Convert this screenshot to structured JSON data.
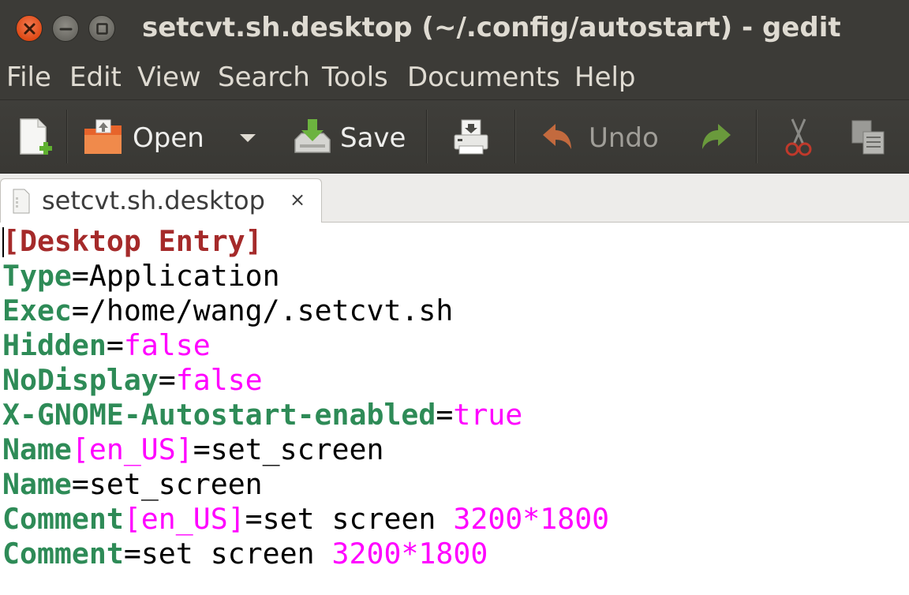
{
  "window": {
    "title": "setcvt.sh.desktop (~/.config/autostart) - gedit"
  },
  "menu": [
    "File",
    "Edit",
    "View",
    "Search",
    "Tools",
    "Documents",
    "Help"
  ],
  "toolbar": {
    "new_icon": "new-document-icon",
    "open_label": "Open",
    "save_label": "Save",
    "print_icon": "print-icon",
    "undo_label": "Undo",
    "redo_icon": "redo-icon",
    "cut_icon": "cut-icon",
    "copy_icon": "copy-icon"
  },
  "tab": {
    "label": "setcvt.sh.desktop",
    "close": "×"
  },
  "editor": {
    "lines": [
      {
        "section": "[Desktop Entry]"
      },
      {
        "key": "Type",
        "eq": "=",
        "value": "Application"
      },
      {
        "key": "Exec",
        "eq": "=",
        "value": "/home/wang/.setcvt.sh"
      },
      {
        "key": "Hidden",
        "eq": "=",
        "value_kw": "false"
      },
      {
        "key": "NoDisplay",
        "eq": "=",
        "value_kw": "false"
      },
      {
        "key": "X-GNOME-Autostart-enabled",
        "eq": "=",
        "value_kw": "true"
      },
      {
        "key": "Name",
        "locale": "[en_US]",
        "eq": "=",
        "value": "set_screen"
      },
      {
        "key": "Name",
        "eq": "=",
        "value": "set_screen"
      },
      {
        "key": "Comment",
        "locale": "[en_US]",
        "eq": "=",
        "value": "set screen ",
        "value_num": "3200*1800"
      },
      {
        "key": "Comment",
        "eq": "=",
        "value": "set screen ",
        "value_num": "3200*1800"
      }
    ]
  },
  "colors": {
    "section": "#a52a2a",
    "key": "#2e8b57",
    "keyword": "#ff00ff",
    "titlebar": "#3c3b37"
  }
}
